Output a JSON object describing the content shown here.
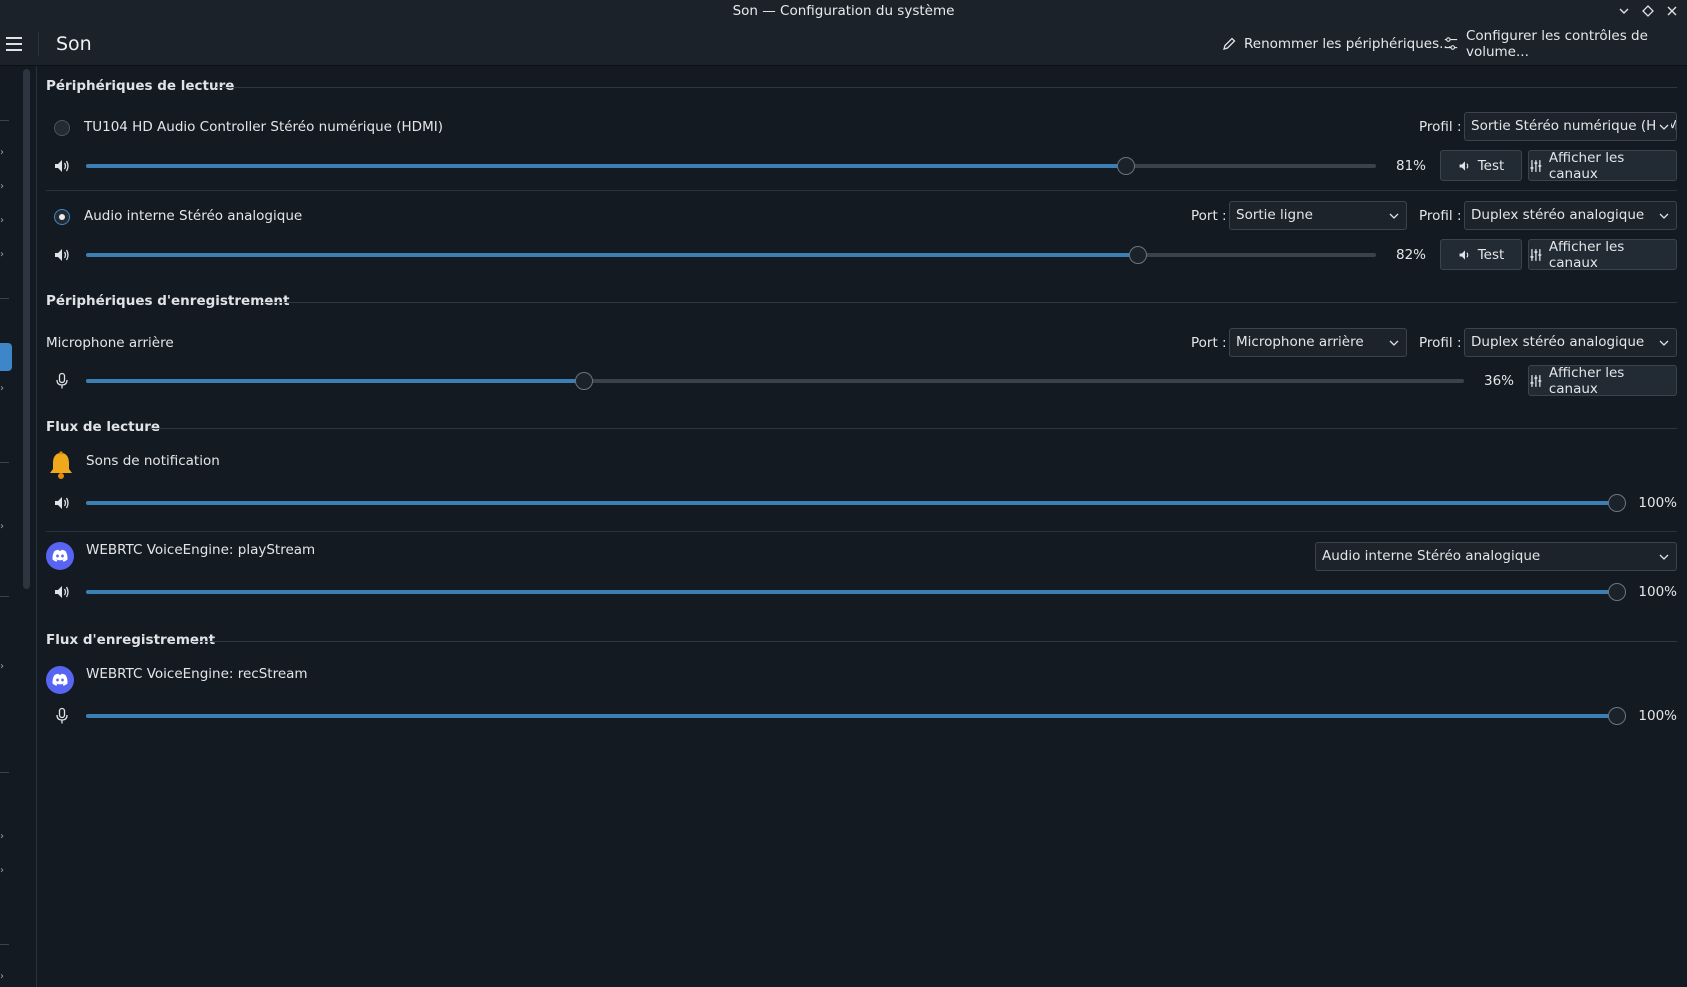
{
  "window": {
    "title": "Son — Configuration du système"
  },
  "header": {
    "page_title": "Son",
    "rename_label": "Renommer les périphériques...",
    "configure_label": "Configurer les contrôles de volume..."
  },
  "sections": {
    "playback_devices": "Périphériques de lecture",
    "recording_devices": "Périphériques d'enregistrement",
    "playback_streams": "Flux de lecture",
    "recording_streams": "Flux d'enregistrement"
  },
  "common": {
    "port_label": "Port :",
    "profile_label": "Profil :",
    "test_label": "Test",
    "channels_label": "Afficher les canaux"
  },
  "playback_devices": [
    {
      "name": "TU104 HD Audio Controller Stéréo numérique (HDMI)",
      "default": false,
      "profile": "Sortie Stéréo numérique (HDMI)",
      "volume": 81,
      "volume_text": "81%"
    },
    {
      "name": "Audio interne Stéréo analogique",
      "default": true,
      "port": "Sortie ligne",
      "profile": "Duplex stéréo analogique",
      "volume": 82,
      "volume_text": "82%"
    }
  ],
  "recording_devices": [
    {
      "name": "Microphone arrière",
      "port": "Microphone arrière",
      "profile": "Duplex stéréo analogique",
      "volume": 36,
      "volume_text": "36%"
    }
  ],
  "playback_streams": [
    {
      "name": "Sons de notification",
      "icon": "bell-icon",
      "volume": 100,
      "volume_text": "100%"
    },
    {
      "name": "WEBRTC VoiceEngine: playStream",
      "icon": "discord-icon",
      "device": "Audio interne Stéréo analogique",
      "volume": 100,
      "volume_text": "100%"
    }
  ],
  "recording_streams": [
    {
      "name": "WEBRTC VoiceEngine: recStream",
      "icon": "discord-icon",
      "volume": 100,
      "volume_text": "100%"
    }
  ],
  "colors": {
    "accent": "#3d86c7",
    "slider_fill": "#3b7fb5",
    "background": "#141a21",
    "discord": "#5865f2",
    "bell": "#f0a81c"
  }
}
